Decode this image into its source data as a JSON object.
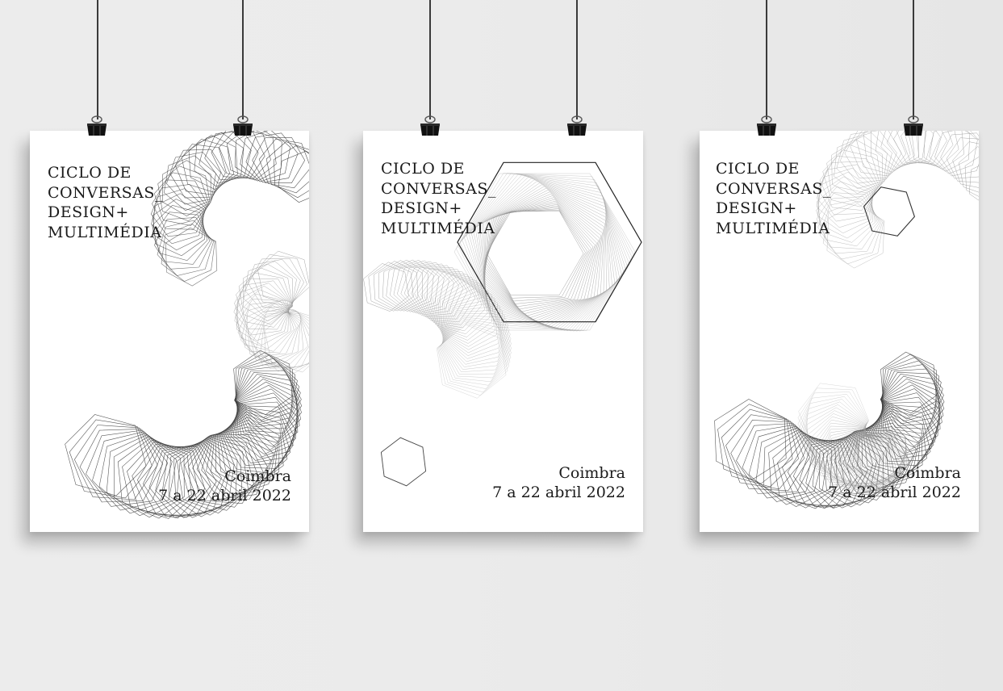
{
  "posters": [
    {
      "title_lines": [
        "CICLO DE",
        "CONVERSAS_",
        "DESIGN+",
        "MULTIMÉDIA"
      ],
      "city": "Coimbra",
      "dates": "7 a 22 abril 2022"
    },
    {
      "title_lines": [
        "CICLO DE",
        "CONVERSAS_",
        "DESIGN+",
        "MULTIMÉDIA"
      ],
      "city": "Coimbra",
      "dates": "7 a 22 abril 2022"
    },
    {
      "title_lines": [
        "CICLO DE",
        "CONVERSAS_",
        "DESIGN+",
        "MULTIMÉDIA"
      ],
      "city": "Coimbra",
      "dates": "7 a 22 abril 2022"
    }
  ],
  "colors": {
    "wall": "#ebebeb",
    "paper": "#ffffff",
    "ink": "#1a1a1a",
    "line_art_dark": "#3c3c3c",
    "line_art_light": "#9a9a9a",
    "wire": "#3a3a3a",
    "clip": "#111111"
  },
  "icons": [
    "binder-clip-icon"
  ]
}
